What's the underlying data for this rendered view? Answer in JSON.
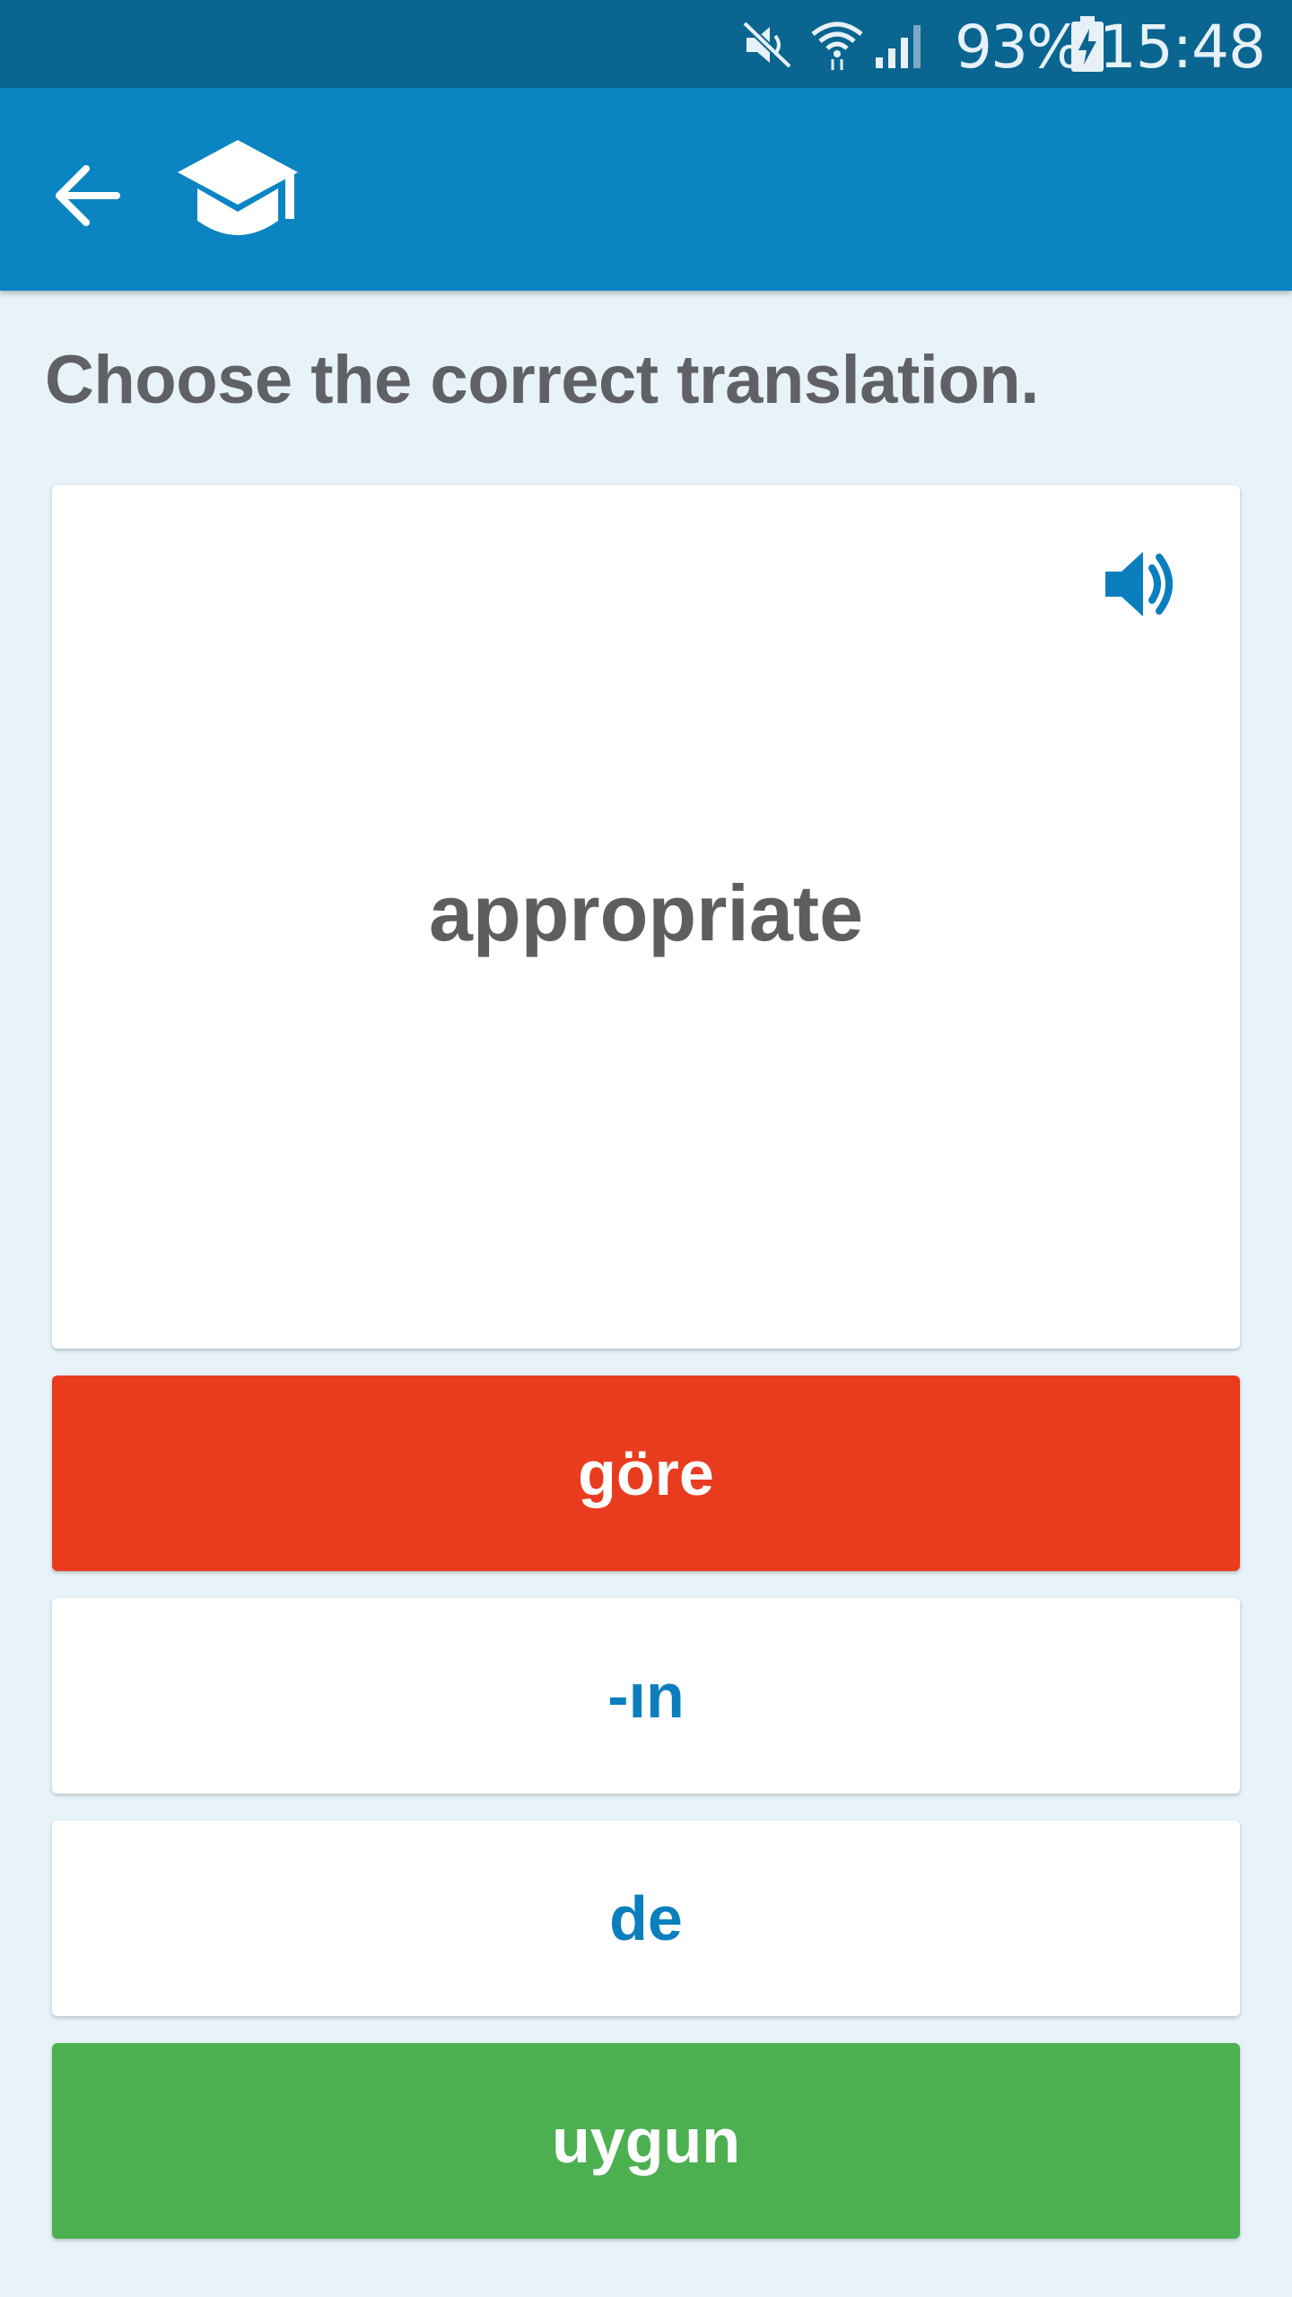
{
  "status_bar": {
    "battery_percent": "93%",
    "time": "15:48",
    "icons": [
      "mute-icon",
      "wifi-icon",
      "signal-icon",
      "battery-charging-icon"
    ]
  },
  "toolbar": {
    "back_icon": "arrow-left-icon",
    "logo_icon": "graduation-cap-icon"
  },
  "question": {
    "prompt": "Choose the correct translation."
  },
  "card": {
    "word": "appropriate",
    "audio_icon": "speaker-icon"
  },
  "answers": [
    {
      "label": "göre",
      "state": "incorrect"
    },
    {
      "label": "-ın",
      "state": "default"
    },
    {
      "label": "de",
      "state": "default"
    },
    {
      "label": "uygun",
      "state": "correct"
    }
  ],
  "colors": {
    "status_bar": "#0a6591",
    "toolbar": "#0b85c1",
    "background": "#e7f3f8",
    "incorrect": "#e93c1f",
    "correct": "#4caf50",
    "answer_text": "#0b7fbd"
  }
}
